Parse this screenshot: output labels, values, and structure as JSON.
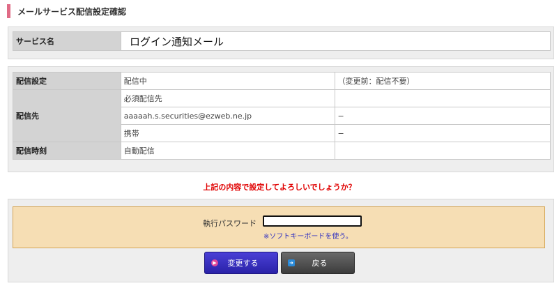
{
  "header": {
    "title": "メールサービス配信設定確認"
  },
  "service": {
    "label": "サービス名",
    "value": "ログイン通知メール"
  },
  "settings": {
    "delivery_setting": {
      "label": "配信設定",
      "value": "配信中",
      "note": "（変更前：配信不要）"
    },
    "destination": {
      "label": "配信先",
      "rows": [
        {
          "value": "必須配信先",
          "note": ""
        },
        {
          "value": "aaaaah.s.securities@ezweb.ne.jp",
          "note": "−"
        },
        {
          "value": "携帯",
          "note": "−"
        }
      ]
    },
    "time": {
      "label": "配信時刻",
      "value": "自動配信",
      "note": ""
    }
  },
  "confirm_text": "上記の内容で設定してよろしいでしょうか？",
  "password": {
    "label": "執行パスワード",
    "value": "",
    "keyboard_link": "※ソフトキーボードを使う。"
  },
  "buttons": {
    "change": "変更する",
    "back": "戻る"
  },
  "colors": {
    "accent": "#e06b86",
    "warning": "#e00000",
    "password_bg": "#f6deb4",
    "change_button": "#2a22a8",
    "back_button": "#3c3c3c"
  }
}
